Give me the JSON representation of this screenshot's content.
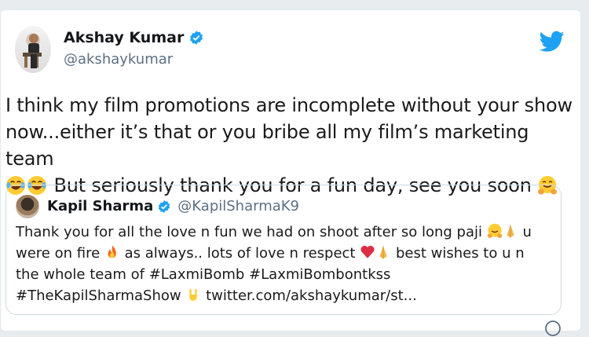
{
  "author": {
    "name": "Akshay Kumar",
    "handle": "@akshaykumar"
  },
  "tweet": {
    "line1": "I think my film promotions are incomplete without your show",
    "line2": "now...either it’s that or you bribe all my film’s marketing team",
    "line3": "But seriously thank you for a fun day, see you soon"
  },
  "quoted": {
    "name": "Kapil Sharma",
    "handle": "@KapilSharmaK9",
    "l1": "Thank you for all the love n fun we had on shoot after so long paji",
    "l1b": "u",
    "l2a": "were on fire",
    "l2b": "as always.. lots of love n respect",
    "l2c": "best wishes to u n",
    "l3": "the whole team of #LaxmiBomb #LaxmiBombontkss",
    "l4a": "#TheKapilSharmaShow",
    "l4b": "twitter.com/akshaykumar/st..."
  },
  "colors": {
    "brand": "#1da1f2",
    "handle": "#5b7083",
    "border": "#cfd9de"
  },
  "icons": [
    "verified-badge-icon",
    "twitter-bird-icon",
    "laughing-emoji-icon",
    "hug-emoji-icon",
    "folded-hands-emoji-icon",
    "fire-emoji-icon",
    "heart-emoji-icon",
    "rock-hand-emoji-icon",
    "info-icon"
  ]
}
